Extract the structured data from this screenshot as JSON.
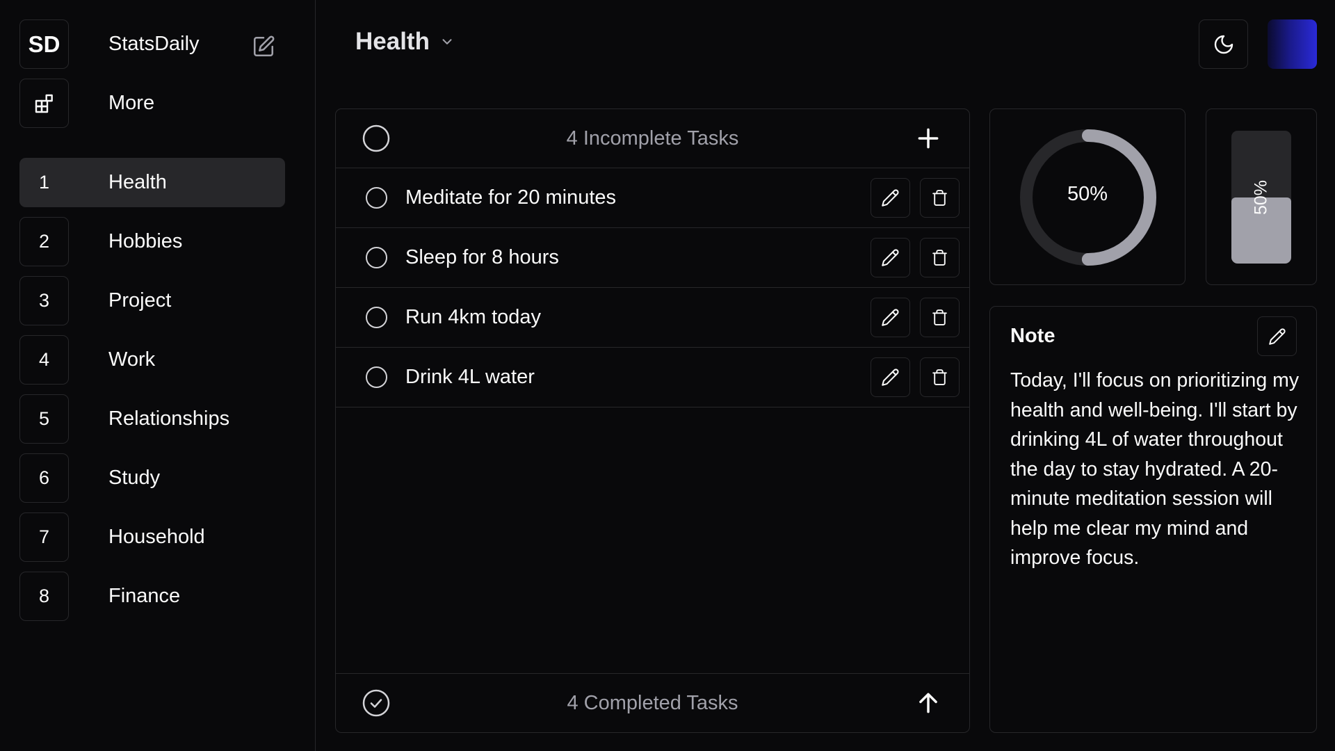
{
  "app": {
    "brand_initials": "SD",
    "brand_name": "StatsDaily"
  },
  "sidebar": {
    "more_label": "More",
    "items": [
      {
        "number": "1",
        "label": "Health",
        "active": true
      },
      {
        "number": "2",
        "label": "Hobbies"
      },
      {
        "number": "3",
        "label": "Project"
      },
      {
        "number": "4",
        "label": "Work"
      },
      {
        "number": "5",
        "label": "Relationships"
      },
      {
        "number": "6",
        "label": "Study"
      },
      {
        "number": "7",
        "label": "Household"
      },
      {
        "number": "8",
        "label": "Finance"
      }
    ]
  },
  "header": {
    "title": "Health"
  },
  "tasks": {
    "incomplete_title": "4 Incomplete Tasks",
    "completed_title": "4 Completed Tasks",
    "items": [
      {
        "text": "Meditate for 20 minutes"
      },
      {
        "text": "Sleep for 8 hours"
      },
      {
        "text": "Run 4km today"
      },
      {
        "text": "Drink 4L water"
      }
    ]
  },
  "stats": {
    "ring_label": "50%",
    "ring_value": 0.5,
    "bar_label": "50%",
    "bar_value": 0.5
  },
  "note": {
    "title": "Note",
    "body": "Today, I'll focus on prioritizing my health and well-being. I'll start by drinking 4L of water throughout the day to stay hydrated. A 20-minute meditation session will help me clear my mind and improve focus."
  },
  "colors": {
    "background": "#09090b",
    "border": "#27272a",
    "ring_progress": "#a1a1aa",
    "avatar_gradient_end": "#2a2ad8"
  },
  "icons": {
    "edit": "pencil-square-icon",
    "more": "grid-plus-icon",
    "dropdown": "chevron-down-icon",
    "theme": "moon-icon",
    "add": "plus-icon",
    "task_edit": "pencil-icon",
    "task_delete": "trash-icon",
    "completed": "check-circle-icon",
    "collapse": "arrow-up-icon"
  }
}
